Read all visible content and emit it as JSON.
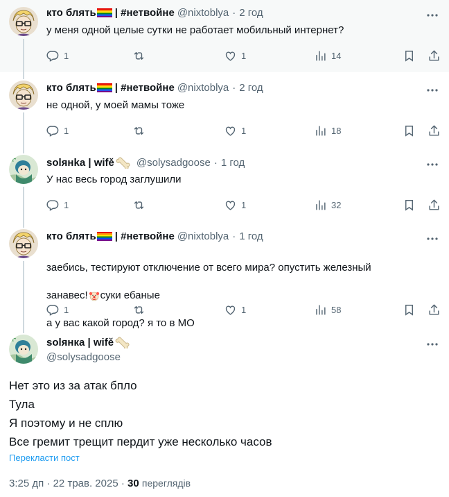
{
  "tweets": [
    {
      "name": "кто блять",
      "name_suffix": " | #нетвойне",
      "handle": "@nixtoblya",
      "time": "2 год",
      "text": "у меня одной целые сутки не работает мобильный интернет?",
      "replies": "1",
      "retweets": "",
      "likes": "1",
      "views": "14"
    },
    {
      "name": "кто блять",
      "name_suffix": " | #нетвойне",
      "handle": "@nixtoblya",
      "time": "2 год",
      "text": "не одной, у моей мамы тоже",
      "replies": "1",
      "retweets": "",
      "likes": "1",
      "views": "18"
    },
    {
      "name": "solянka | wifě",
      "handle": "@solysadgoose",
      "time": "1 год",
      "text": "У нас весь город заглушили",
      "replies": "1",
      "retweets": "",
      "likes": "1",
      "views": "32"
    },
    {
      "name": "кто блять",
      "name_suffix": " | #нетвойне",
      "handle": "@nixtoblya",
      "time": "1 год",
      "text_line1": "заебись, тестируют отключение от всего мира? опустить железный",
      "text_line2a": "занавес!",
      "text_line2b": "суки ебаные",
      "text_line3": "а у вас какой город? я то в МО",
      "replies": "1",
      "retweets": "",
      "likes": "1",
      "views": "58"
    }
  ],
  "main": {
    "name": "solянка | wifě",
    "handle": "@solysadgoose",
    "text": "Нет это из за атак бпло\nТула\nЯ поэтому и не сплю\nВсе гремит трещит пердит уже несколько часов",
    "translate": "Перекласти пост",
    "time": "3:25 дп",
    "date": "22 трав. 2025",
    "views_count": "30",
    "views_label": "переглядів"
  },
  "icons": [
    "reply-icon",
    "retweet-icon",
    "like-icon",
    "views-icon",
    "bookmark-icon",
    "share-icon",
    "more-icon",
    "rainbow-flag-icon",
    "bone-icon",
    "clown-icon"
  ],
  "colors": {
    "text": "#0f1419",
    "secondary": "#536471",
    "link": "#1d9bf0",
    "line": "#cfd9de",
    "highlight": "#f7f9f9"
  }
}
